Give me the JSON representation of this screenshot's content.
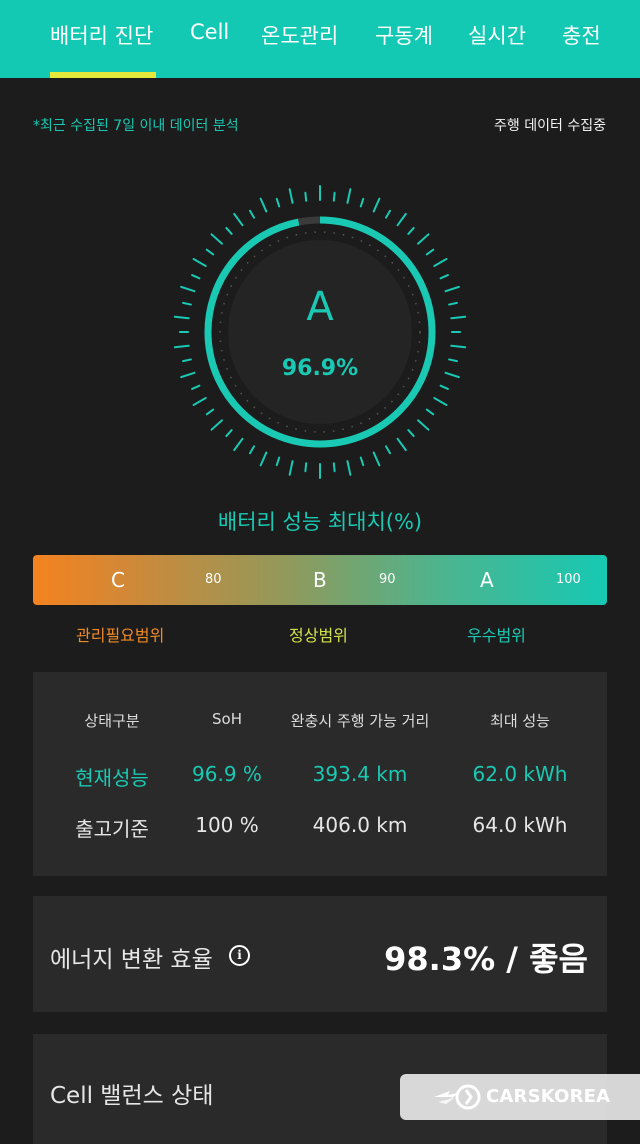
{
  "tabs": [
    {
      "label": "배터리 진단",
      "active": true
    },
    {
      "label": "Cell"
    },
    {
      "label": "온도관리"
    },
    {
      "label": "구동계"
    },
    {
      "label": "실시간"
    },
    {
      "label": "충전"
    }
  ],
  "notes": {
    "left": "*최근 수집된 7일 이내 데이터 분석",
    "right": "주행 데이터 수집중"
  },
  "gauge": {
    "grade": "A",
    "value_text": "96.9%",
    "value_percent": 96.9
  },
  "performance_title": "배터리 성능 최대치(%)",
  "grade_bar": {
    "letters": [
      "C",
      "B",
      "A"
    ],
    "thresholds": [
      "80",
      "90",
      "100"
    ]
  },
  "ranges": {
    "needs_care": "관리필요범위",
    "normal": "정상범위",
    "excellent": "우수범위"
  },
  "status_table": {
    "headers": [
      "상태구분",
      "SoH",
      "완충시 주행 가능 거리",
      "최대 성능"
    ],
    "current": [
      "현재성능",
      "96.9 %",
      "393.4 km",
      "62.0 kWh"
    ],
    "factory": [
      "출고기준",
      "100 %",
      "406.0 km",
      "64.0 kWh"
    ]
  },
  "efficiency": {
    "label": "에너지 변환 효율",
    "value": "98.3% / 좋음"
  },
  "cell_balance": {
    "label": "Cell 밸런스 상태"
  },
  "watermark": {
    "text": "CARSKOREA"
  },
  "colors": {
    "accent": "#19c9b3",
    "tabbar": "#14c9b4",
    "tab_underline": "#e4e83a",
    "warning": "#f08a24",
    "normal": "#d2e24a"
  }
}
